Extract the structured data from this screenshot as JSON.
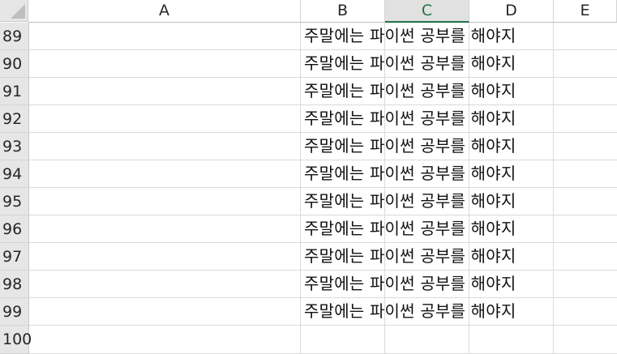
{
  "columns": [
    {
      "label": "A",
      "selected": false
    },
    {
      "label": "B",
      "selected": false
    },
    {
      "label": "C",
      "selected": true
    },
    {
      "label": "D",
      "selected": false
    },
    {
      "label": "E",
      "selected": false
    }
  ],
  "rows": [
    {
      "number": "89",
      "b_text": "주말에는 파이썬 공부를 해야지"
    },
    {
      "number": "90",
      "b_text": "주말에는 파이썬 공부를 해야지"
    },
    {
      "number": "91",
      "b_text": "주말에는 파이썬 공부를 해야지"
    },
    {
      "number": "92",
      "b_text": "주말에는 파이썬 공부를 해야지"
    },
    {
      "number": "93",
      "b_text": "주말에는 파이썬 공부를 해야지"
    },
    {
      "number": "94",
      "b_text": "주말에는 파이썬 공부를 해야지"
    },
    {
      "number": "95",
      "b_text": "주말에는 파이썬 공부를 해야지"
    },
    {
      "number": "96",
      "b_text": "주말에는 파이썬 공부를 해야지"
    },
    {
      "number": "97",
      "b_text": "주말에는 파이썬 공부를 해야지"
    },
    {
      "number": "98",
      "b_text": "주말에는 파이썬 공부를 해야지"
    },
    {
      "number": "99",
      "b_text": "주말에는 파이썬 공부를 해야지"
    },
    {
      "number": "100",
      "b_text": ""
    }
  ],
  "colors": {
    "header_bg": "#e6e6e6",
    "selected_header_accent": "#217346",
    "gridline": "#dadada"
  }
}
